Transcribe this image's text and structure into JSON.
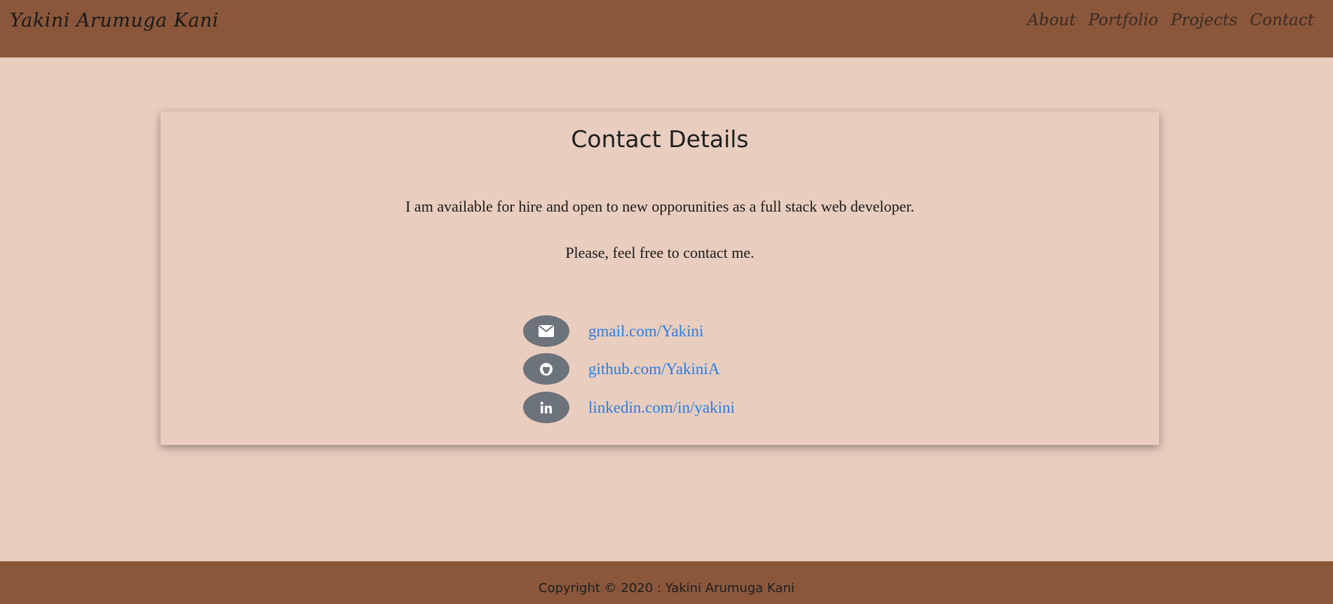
{
  "header": {
    "brand": "Yakini Arumuga Kani",
    "nav": [
      "About",
      "Portfolio",
      "Projects",
      "Contact"
    ]
  },
  "card": {
    "title": "Contact Details",
    "paragraph1": "I am available for hire and open to new opporunities as a full stack web developer.",
    "paragraph2": "Please, feel free to contact me.",
    "contacts": [
      {
        "icon": "envelope-icon",
        "text": "gmail.com/Yakini"
      },
      {
        "icon": "github-icon",
        "text": "github.com/YakiniA"
      },
      {
        "icon": "linkedin-icon",
        "text": "linkedin.com/in/yakini"
      }
    ]
  },
  "footer": {
    "text": "Copyright © 2020 : Yakini Arumuga Kani"
  },
  "colors": {
    "header_bg": "#8b573b",
    "page_bg": "#e9cdbf",
    "icon_bg": "#6c737a",
    "link": "#2a7ee0"
  }
}
